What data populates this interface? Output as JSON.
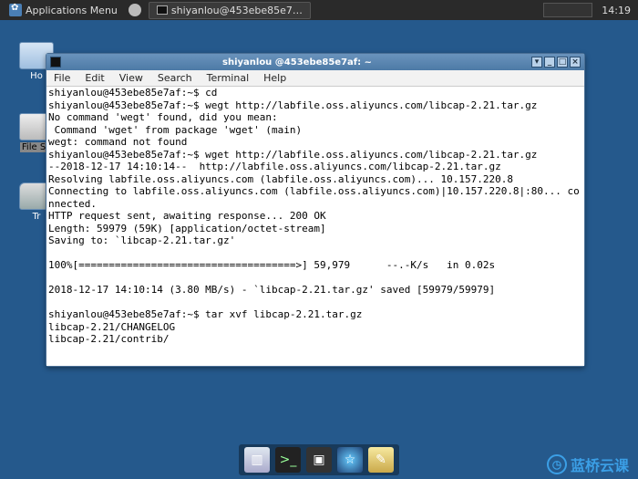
{
  "panel": {
    "appmenu": "Applications Menu",
    "task": "shiyanlou@453ebe85e7…",
    "clock": "14:19"
  },
  "desktop": {
    "home": "Ho",
    "filesystem": "File Sy",
    "trash": "Tr"
  },
  "window": {
    "title": "shiyanlou @453ebe85e7af: ~",
    "menu": {
      "file": "File",
      "edit": "Edit",
      "view": "View",
      "search": "Search",
      "terminal": "Terminal",
      "help": "Help"
    }
  },
  "terminal": {
    "lines": [
      "shiyanlou@453ebe85e7af:~$ cd",
      "shiyanlou@453ebe85e7af:~$ wegt http://labfile.oss.aliyuncs.com/libcap-2.21.tar.gz",
      "No command 'wegt' found, did you mean:",
      " Command 'wget' from package 'wget' (main)",
      "wegt: command not found",
      "shiyanlou@453ebe85e7af:~$ wget http://labfile.oss.aliyuncs.com/libcap-2.21.tar.gz",
      "--2018-12-17 14:10:14--  http://labfile.oss.aliyuncs.com/libcap-2.21.tar.gz",
      "Resolving labfile.oss.aliyuncs.com (labfile.oss.aliyuncs.com)... 10.157.220.8",
      "Connecting to labfile.oss.aliyuncs.com (labfile.oss.aliyuncs.com)|10.157.220.8|:80... connected.",
      "HTTP request sent, awaiting response... 200 OK",
      "Length: 59979 (59K) [application/octet-stream]",
      "Saving to: `libcap-2.21.tar.gz'",
      "",
      "100%[====================================>] 59,979      --.-K/s   in 0.02s",
      "",
      "2018-12-17 14:10:14 (3.80 MB/s) - `libcap-2.21.tar.gz' saved [59979/59979]",
      "",
      "shiyanlou@453ebe85e7af:~$ tar xvf libcap-2.21.tar.gz",
      "libcap-2.21/CHANGELOG",
      "libcap-2.21/contrib/"
    ]
  },
  "brand": "蓝桥云课"
}
